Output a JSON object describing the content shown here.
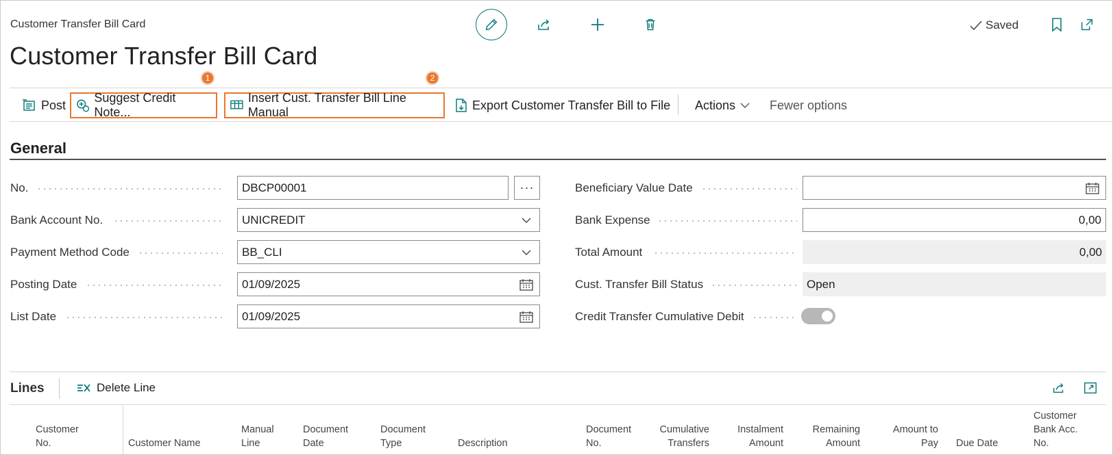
{
  "header": {
    "breadcrumb": "Customer Transfer Bill Card",
    "title": "Customer Transfer Bill Card",
    "saved_label": "Saved"
  },
  "callouts": [
    "1",
    "2"
  ],
  "actions": {
    "post": "Post",
    "suggest_credit_note": "Suggest Credit Note...",
    "insert_line_manual": "Insert Cust. Transfer Bill Line Manual",
    "export_to_file": "Export Customer Transfer Bill to File",
    "actions_menu": "Actions",
    "fewer_options": "Fewer options"
  },
  "general": {
    "title": "General",
    "left_fields": [
      {
        "label": "No.",
        "value": "DBCP00001"
      },
      {
        "label": "Bank Account No.",
        "value": "UNICREDIT"
      },
      {
        "label": "Payment Method Code",
        "value": "BB_CLI"
      },
      {
        "label": "Posting Date",
        "value": "01/09/2025"
      },
      {
        "label": "List Date",
        "value": "01/09/2025"
      }
    ],
    "right_fields": [
      {
        "label": "Beneficiary Value Date",
        "value": ""
      },
      {
        "label": "Bank Expense",
        "value": "0,00"
      },
      {
        "label": "Total Amount",
        "value": "0,00"
      },
      {
        "label": "Cust. Transfer Bill Status",
        "value": "Open"
      },
      {
        "label": "Credit Transfer Cumulative Debit",
        "value": "on"
      }
    ]
  },
  "lines": {
    "title": "Lines",
    "delete_line": "Delete Line",
    "columns": [
      {
        "l1": "Customer",
        "l2": "No."
      },
      {
        "l1": "",
        "l2": "Customer Name"
      },
      {
        "l1": "Manual",
        "l2": "Line"
      },
      {
        "l1": "Document",
        "l2": "Date"
      },
      {
        "l1": "Document",
        "l2": "Type"
      },
      {
        "l1": "",
        "l2": "Description"
      },
      {
        "l1": "Document",
        "l2": "No."
      },
      {
        "l1": "Cumulative",
        "l2": "Transfers"
      },
      {
        "l1": "Instalment",
        "l2": "Amount"
      },
      {
        "l1": "Remaining",
        "l2": "Amount"
      },
      {
        "l1": "Amount to",
        "l2": "Pay"
      },
      {
        "l1": "",
        "l2": "Due Date"
      },
      {
        "l0": "Customer",
        "l1": "Bank Acc.",
        "l2": "No."
      }
    ]
  },
  "colors": {
    "accent": "#0f7b7b",
    "highlight": "#e8772e"
  }
}
